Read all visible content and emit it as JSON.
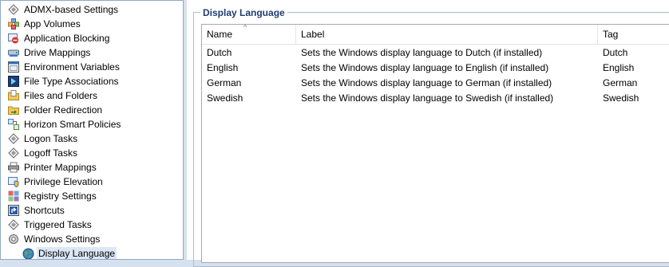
{
  "tree": {
    "items": [
      {
        "label": "ADMX-based Settings",
        "icon": "admx-settings-icon"
      },
      {
        "label": "App Volumes",
        "icon": "app-volumes-icon"
      },
      {
        "label": "Application Blocking",
        "icon": "application-blocking-icon"
      },
      {
        "label": "Drive Mappings",
        "icon": "drive-mappings-icon"
      },
      {
        "label": "Environment Variables",
        "icon": "environment-variables-icon"
      },
      {
        "label": "File Type Associations",
        "icon": "file-type-associations-icon"
      },
      {
        "label": "Files and Folders",
        "icon": "files-and-folders-icon"
      },
      {
        "label": "Folder Redirection",
        "icon": "folder-redirection-icon"
      },
      {
        "label": "Horizon Smart Policies",
        "icon": "horizon-smart-policies-icon"
      },
      {
        "label": "Logon Tasks",
        "icon": "logon-tasks-icon"
      },
      {
        "label": "Logoff Tasks",
        "icon": "logoff-tasks-icon"
      },
      {
        "label": "Printer Mappings",
        "icon": "printer-mappings-icon"
      },
      {
        "label": "Privilege Elevation",
        "icon": "privilege-elevation-icon"
      },
      {
        "label": "Registry Settings",
        "icon": "registry-settings-icon"
      },
      {
        "label": "Shortcuts",
        "icon": "shortcuts-icon"
      },
      {
        "label": "Triggered Tasks",
        "icon": "triggered-tasks-icon"
      },
      {
        "label": "Windows Settings",
        "icon": "windows-settings-icon"
      }
    ],
    "child": {
      "label": "Display Language",
      "icon": "globe-icon"
    }
  },
  "panel": {
    "group_title": "Display Language",
    "columns": [
      "Name",
      "Label",
      "Tag"
    ],
    "rows": [
      {
        "name": "Dutch",
        "label": "Sets the Windows display language to Dutch (if installed)",
        "tag": "Dutch"
      },
      {
        "name": "English",
        "label": "Sets the Windows display language to English (if installed)",
        "tag": "English"
      },
      {
        "name": "German",
        "label": "Sets the Windows display language to German (if installed)",
        "tag": "German"
      },
      {
        "name": "Swedish",
        "label": "Sets the Windows display language to Swedish (if installed)",
        "tag": "Swedish"
      }
    ]
  },
  "colors": {
    "accent": "#1f3d6e",
    "selection": "#dce7f5",
    "frame": "#d6e1ef"
  }
}
